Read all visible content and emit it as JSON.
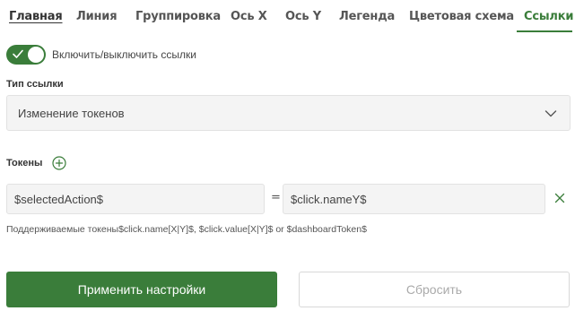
{
  "tabs": [
    {
      "label": "Главная"
    },
    {
      "label": "Линия"
    },
    {
      "label": "Группировка"
    },
    {
      "label": "Ось X"
    },
    {
      "label": "Ось Y"
    },
    {
      "label": "Легенда"
    },
    {
      "label": "Цветовая схема"
    },
    {
      "label": "Ссылки"
    }
  ],
  "active_tab": "Ссылки",
  "links_toggle": {
    "label": "Включить/выключить ссылки",
    "enabled": true
  },
  "link_type": {
    "label": "Тип ссылки",
    "value": "Изменение токенов"
  },
  "tokens": {
    "label": "Токены",
    "rows": [
      {
        "left": "$selectedAction$",
        "operator": "=",
        "right": "$click.nameY$"
      }
    ]
  },
  "hint": "Поддерживаемые токены$click.name[X|Y]$, $click.value[X|Y]$ or $dashboardToken$",
  "actions": {
    "apply_label": "Применить настройки",
    "reset_label": "Сбросить"
  },
  "colors": {
    "accent": "#3a7d3a",
    "field_bg": "#f4f4f4"
  },
  "icons": [
    "check-icon",
    "chevron-down-icon",
    "add-circle-icon",
    "close-icon"
  ]
}
